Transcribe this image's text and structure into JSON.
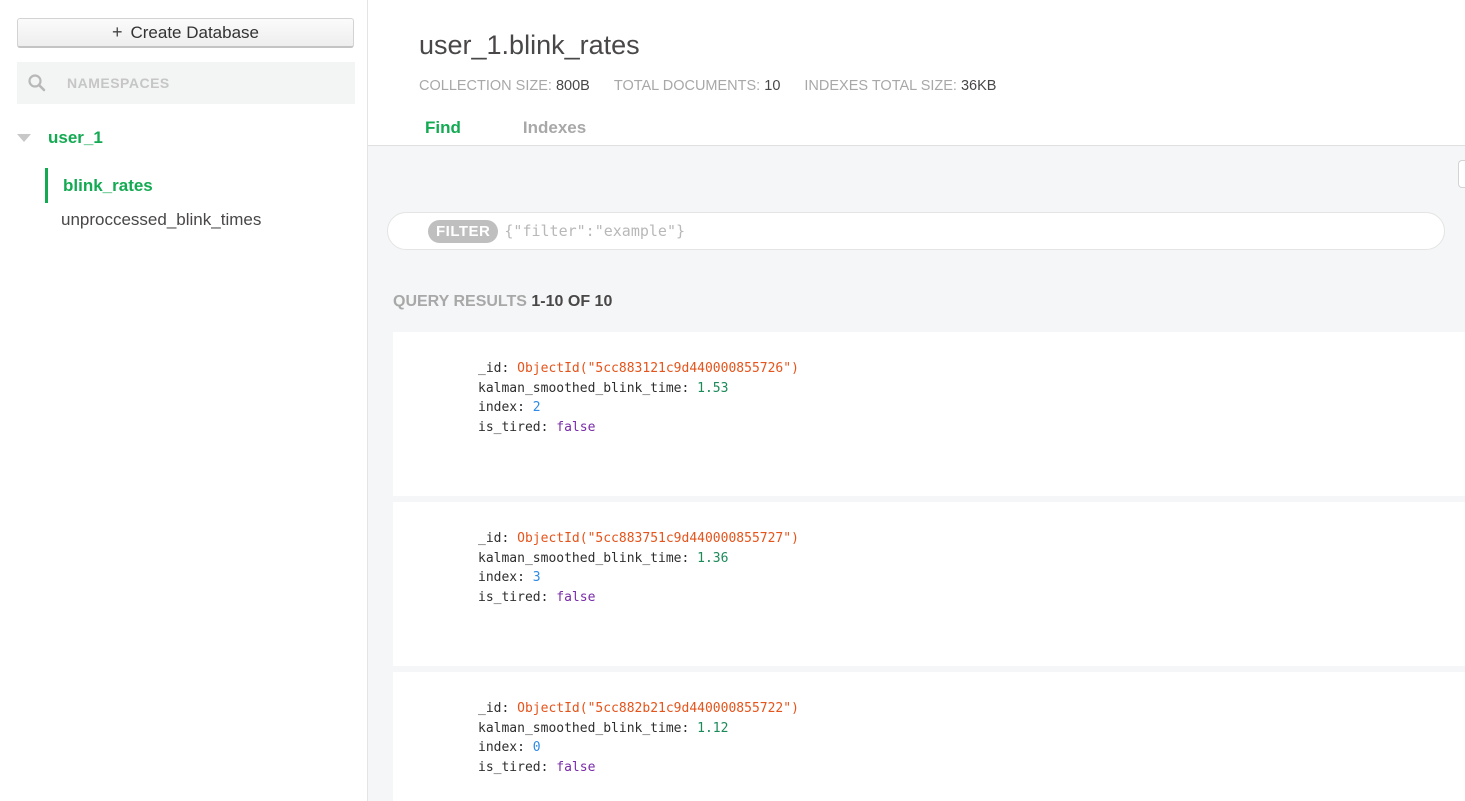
{
  "sidebar": {
    "create_db_label": "Create Database",
    "create_db_icon": "plus-icon",
    "search_placeholder": "NAMESPACES",
    "search_icon": "search-icon",
    "database": {
      "name": "user_1",
      "expanded": true
    },
    "collections": [
      {
        "name": "blink_rates",
        "active": true
      },
      {
        "name": "unproccessed_blink_times",
        "active": false
      }
    ]
  },
  "header": {
    "title": "user_1.blink_rates",
    "stats": [
      {
        "label": "COLLECTION SIZE:",
        "value": "800B"
      },
      {
        "label": "TOTAL DOCUMENTS:",
        "value": "10"
      },
      {
        "label": "INDEXES TOTAL SIZE:",
        "value": "36KB"
      }
    ],
    "tabs": [
      {
        "label": "Find",
        "active": true
      },
      {
        "label": "Indexes",
        "active": false
      }
    ]
  },
  "filter": {
    "badge": "FILTER",
    "placeholder": "{\"filter\":\"example\"}"
  },
  "results": {
    "label": "QUERY RESULTS",
    "range": "1-10 OF 10"
  },
  "documents": [
    {
      "fields": [
        {
          "key": "_id",
          "value": "ObjectId(\"5cc883121c9d440000855726\")"
        },
        {
          "key": "kalman_smoothed_blink_time",
          "value": "1.53"
        },
        {
          "key": "index",
          "value": "2"
        },
        {
          "key": "is_tired",
          "value": "false"
        }
      ]
    },
    {
      "fields": [
        {
          "key": "_id",
          "value": "ObjectId(\"5cc883751c9d440000855727\")"
        },
        {
          "key": "kalman_smoothed_blink_time",
          "value": "1.36"
        },
        {
          "key": "index",
          "value": "3"
        },
        {
          "key": "is_tired",
          "value": "false"
        }
      ]
    },
    {
      "fields": [
        {
          "key": "_id",
          "value": "ObjectId(\"5cc882b21c9d440000855722\")"
        },
        {
          "key": "kalman_smoothed_blink_time",
          "value": "1.12"
        },
        {
          "key": "index",
          "value": "0"
        },
        {
          "key": "is_tired",
          "value": "false"
        }
      ]
    }
  ],
  "colors": {
    "accent_green": "#13aa52",
    "objectid": "#e5541b",
    "number": "#1b8a59",
    "boolean": "#7a2ba8"
  }
}
